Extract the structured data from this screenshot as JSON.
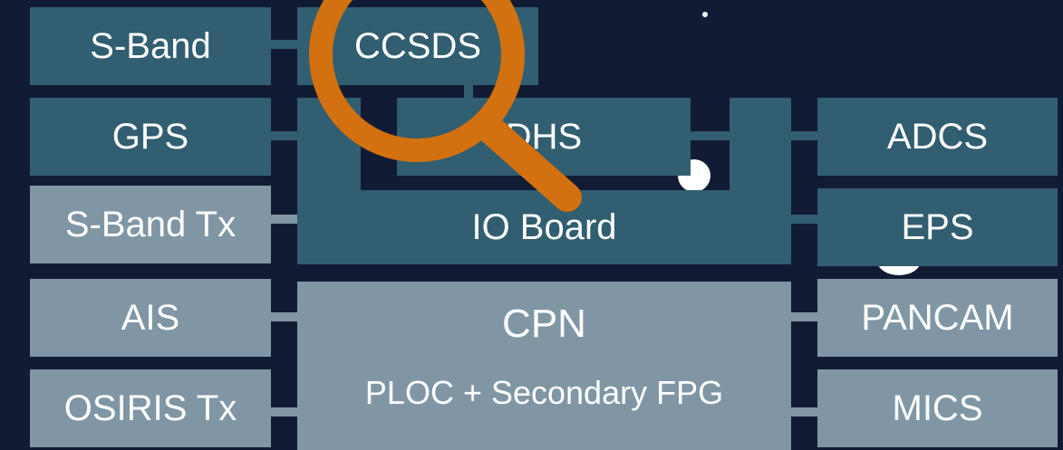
{
  "diagram": {
    "left_column": {
      "s_band": "S-Band",
      "gps": "GPS",
      "s_band_tx": "S-Band Tx",
      "ais": "AIS",
      "osiris_tx": "OSIRIS Tx"
    },
    "center": {
      "ccsds": "CCSDS",
      "dhs": "DHS",
      "io_board": "IO Board",
      "cpn": "CPN",
      "cpn_subtitle": "PLOC + Secondary FPG"
    },
    "right_column": {
      "adcs": "ADCS",
      "eps": "EPS",
      "pancam": "PANCAM",
      "mics": "MICS"
    }
  },
  "colors": {
    "background": "#121b34",
    "dark_block": "#315e70",
    "light_block": "#8096a4",
    "magnifier": "#d3700f",
    "text": "#ffffff"
  },
  "icons": {
    "overlay": "magnifier-icon"
  }
}
